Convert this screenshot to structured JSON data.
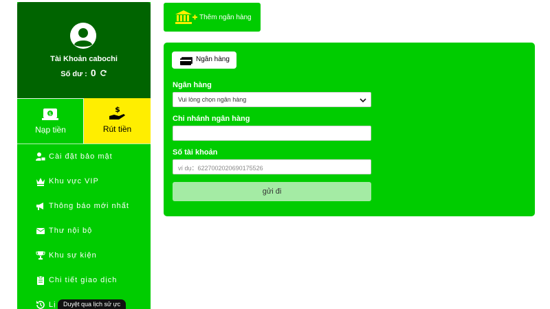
{
  "sidebar": {
    "account_name": "Tài Khoản cabochi",
    "balance_label": "Số dư :",
    "balance_value": "0",
    "actions": [
      {
        "label": "Nạp tiền"
      },
      {
        "label": "Rút tiền"
      }
    ],
    "menu": [
      {
        "label": "Cài đặt bảo mật",
        "icon": "user-lock-icon"
      },
      {
        "label": "Khu vực VIP",
        "icon": "vip-crown-icon"
      },
      {
        "label": "Thông báo mới nhất",
        "icon": "megaphone-icon"
      },
      {
        "label": "Thư nội bộ",
        "icon": "envelope-icon"
      },
      {
        "label": "Khu sự kiện",
        "icon": "trophy-icon"
      },
      {
        "label": "Chi tiết giao dịch",
        "icon": "clipboard-icon"
      },
      {
        "label": "Lị",
        "icon": "history-icon"
      }
    ],
    "tooltip": "Duyệt qua lịch sử",
    "tooltip_suffix": "ực"
  },
  "toolbar": {
    "add_bank_label": "Thêm ngân hàng"
  },
  "form": {
    "tab_label": "Ngân hàng",
    "bank_label": "Ngân hàng",
    "bank_select_value": "Vui lòng chọn ngân hàng",
    "branch_label": "Chi nhánh ngân hàng",
    "branch_value": "",
    "account_label": "Số tài khoản",
    "account_placeholder": "ví dụ：6227002020690175526",
    "submit_label": "gửi đi"
  },
  "colors": {
    "primary_green": "#00cc00",
    "dark_green": "#006400",
    "highlight_yellow": "#ffee00",
    "submit_disabled": "#a4eba4"
  }
}
